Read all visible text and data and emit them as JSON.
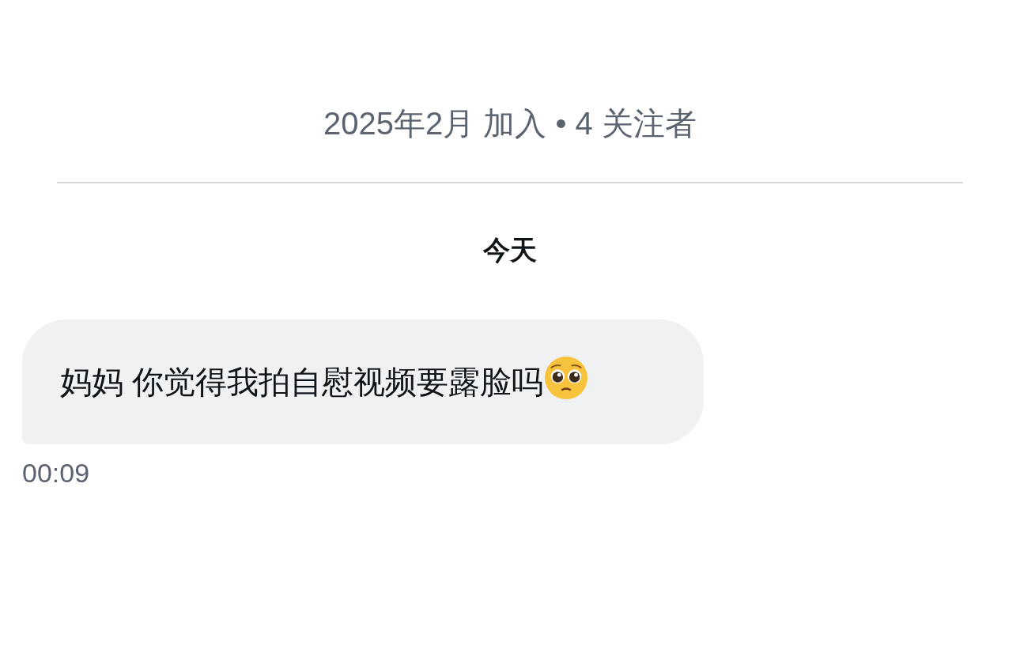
{
  "profile_meta": "2025年2月 加入 • 4 关注者",
  "date_divider": "今天",
  "messages": [
    {
      "text": "妈妈 你觉得我拍自慰视频要露脸吗",
      "time": "00:09"
    }
  ]
}
